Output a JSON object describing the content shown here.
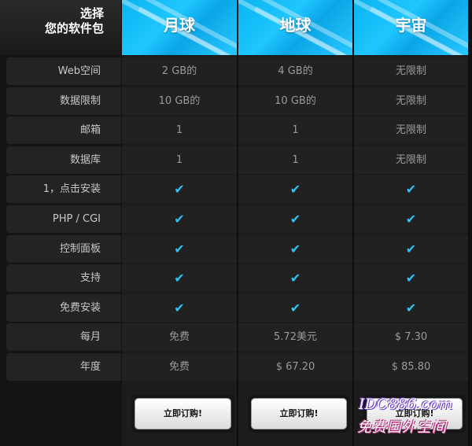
{
  "header": {
    "label_line1": "选择",
    "label_line2": "您的软件包"
  },
  "plans": [
    {
      "name": "月球",
      "order_label": "立即订购!"
    },
    {
      "name": "地球",
      "order_label": "立即订购!"
    },
    {
      "name": "宇宙",
      "order_label": "立即订购!"
    }
  ],
  "rows": [
    {
      "label": "Web空间",
      "values": [
        "2 GB的",
        "4 GB的",
        "无限制"
      ]
    },
    {
      "label": "数据限制",
      "values": [
        "10 GB的",
        "10 GB的",
        "无限制"
      ]
    },
    {
      "label": "邮箱",
      "values": [
        "1",
        "1",
        "无限制"
      ]
    },
    {
      "label": "数据库",
      "values": [
        "1",
        "1",
        "无限制"
      ]
    },
    {
      "label": "1，点击安装",
      "values": [
        "✔",
        "✔",
        "✔"
      ]
    },
    {
      "label": "PHP / CGI",
      "values": [
        "✔",
        "✔",
        "✔"
      ]
    },
    {
      "label": "控制面板",
      "values": [
        "✔",
        "✔",
        "✔"
      ]
    },
    {
      "label": "支持",
      "values": [
        "✔",
        "✔",
        "✔"
      ]
    },
    {
      "label": "免费安装",
      "values": [
        "✔",
        "✔",
        "✔"
      ]
    },
    {
      "label": "每月",
      "values": [
        "免费",
        "5.72美元",
        "$ 7.30"
      ]
    },
    {
      "label": "年度",
      "values": [
        "免费",
        "$ 67.20",
        "$ 85.80"
      ]
    }
  ],
  "watermark": {
    "line1": "IDC886.com",
    "line2": "免费国外空间"
  },
  "colors": {
    "accent": "#2ec4f2",
    "header_blue": "#0ab4f0",
    "background": "#111111"
  }
}
